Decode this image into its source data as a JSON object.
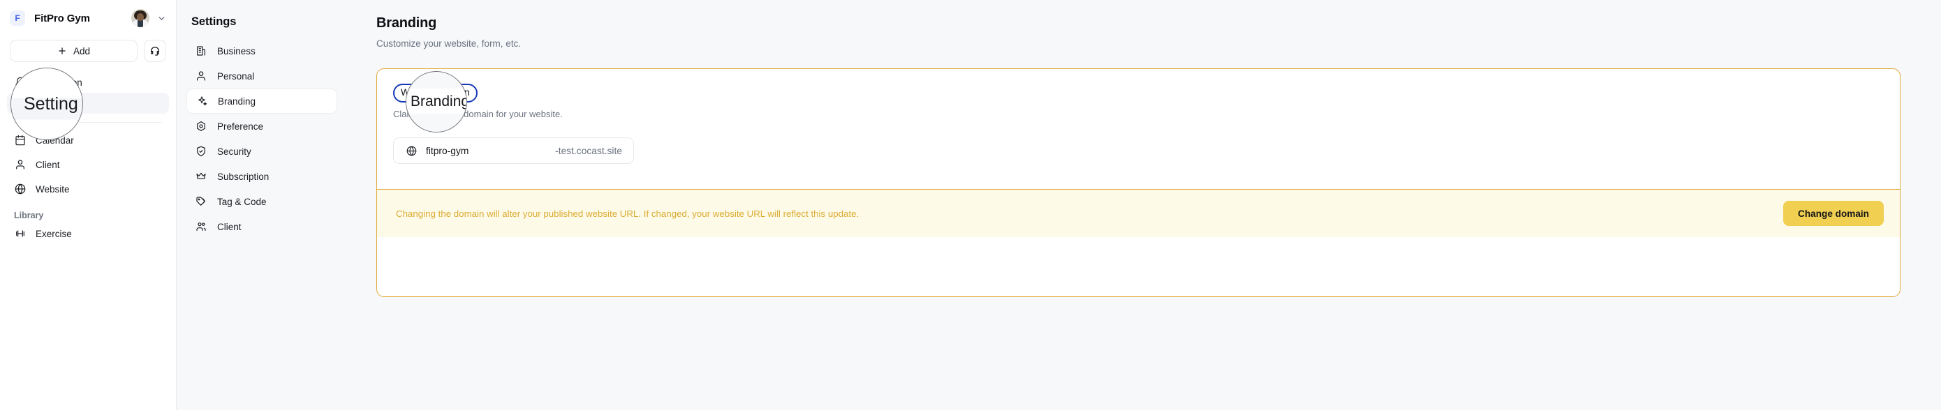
{
  "sidebar": {
    "brand": {
      "badge": "F",
      "name": "FitPro Gym",
      "chevron_icon": "chevron-down-icon"
    },
    "actions": {
      "add_label": "Add",
      "support_icon": "headset-icon"
    },
    "items": [
      {
        "label": "Notification",
        "icon": "bell-icon",
        "active": false
      },
      {
        "label": "Setting",
        "icon": "gear-icon",
        "active": true
      },
      {
        "label": "Calendar",
        "icon": "calendar-icon",
        "active": false
      },
      {
        "label": "Client",
        "icon": "user-icon",
        "active": false
      },
      {
        "label": "Website",
        "icon": "globe-icon",
        "active": false
      }
    ],
    "library_label": "Library",
    "library_items": [
      {
        "label": "Exercise",
        "icon": "dumbbell-icon",
        "active": false
      }
    ]
  },
  "settings_nav": {
    "title": "Settings",
    "items": [
      {
        "label": "Business",
        "icon": "building-icon",
        "active": false
      },
      {
        "label": "Personal",
        "icon": "user-icon",
        "active": false
      },
      {
        "label": "Branding",
        "icon": "sparkle-icon",
        "active": true
      },
      {
        "label": "Preference",
        "icon": "hexagon-target-icon",
        "active": false
      },
      {
        "label": "Security",
        "icon": "shield-check-icon",
        "active": false
      },
      {
        "label": "Subscription",
        "icon": "crown-icon",
        "active": false
      },
      {
        "label": "Tag & Code",
        "icon": "tags-icon",
        "active": false
      },
      {
        "label": "Client",
        "icon": "users-icon",
        "active": false
      }
    ]
  },
  "main": {
    "title": "Branding",
    "subtitle": "Customize your website, form, etc.",
    "field": {
      "label": "Website domain",
      "help": "Claim the unique domain for your website.",
      "globe_icon": "globe-icon",
      "value": "fitpro-gym",
      "suffix": "-test.cocast.site"
    },
    "banner": {
      "text": "Changing the domain will alter your published website URL. If changed, your website URL will reflect this update.",
      "button_label": "Change domain"
    }
  },
  "magnifiers": [
    {
      "id": "setting",
      "text": "Setting"
    },
    {
      "id": "branding",
      "text": "Branding"
    }
  ],
  "colors": {
    "accent_blue": "#4a63e7",
    "highlight_border": "#1639b8",
    "card_border": "#e0a93a",
    "banner_bg": "#fdfbe8",
    "banner_text": "#dbab33",
    "button_bg": "#f0cf51",
    "panel_bg": "#f7f8fa"
  }
}
